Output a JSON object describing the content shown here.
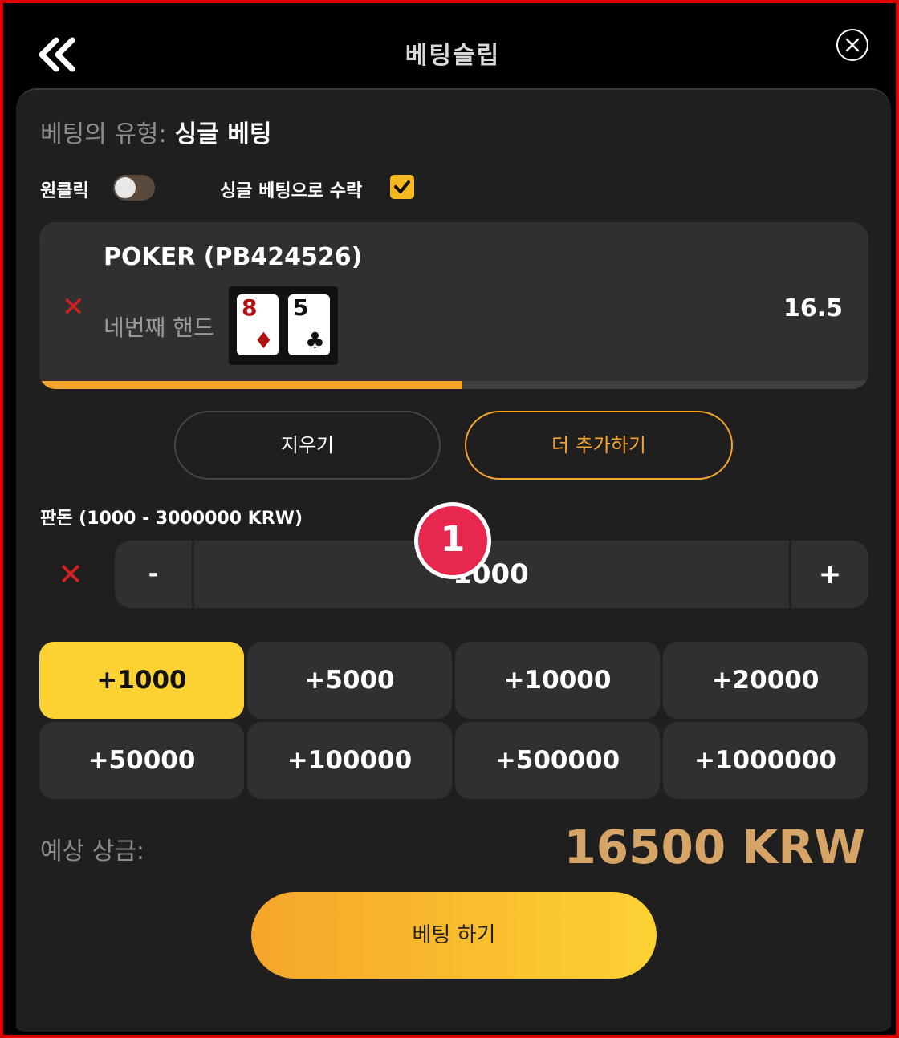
{
  "header": {
    "title": "베팅슬립"
  },
  "bet_type": {
    "label": "베팅의 유형:",
    "value": "싱글 베팅"
  },
  "options": {
    "one_click_label": "원클릭",
    "one_click_on": false,
    "accept_single_label": "싱글 베팅으로 수락",
    "accept_single_checked": true
  },
  "selection": {
    "game": "POKER (PB424526)",
    "market": "네번째 핸드",
    "cards": [
      {
        "rank": "8",
        "suit": "♦",
        "color": "#b01010"
      },
      {
        "rank": "5",
        "suit": "♣",
        "color": "#111111"
      }
    ],
    "odds": "16.5",
    "progress_fraction": 0.51
  },
  "actions": {
    "clear_label": "지우기",
    "add_more_label": "더 추가하기"
  },
  "stake": {
    "label": "판돈 (1000 - 3000000 KRW)",
    "minus": "-",
    "value": "1000",
    "plus": "+",
    "marker": "1"
  },
  "quick_amounts": [
    "+1000",
    "+5000",
    "+10000",
    "+20000",
    "+50000",
    "+100000",
    "+500000",
    "+1000000"
  ],
  "payout": {
    "label": "예상 상금:",
    "value": "16500 KRW"
  },
  "place_bet_label": "베팅 하기",
  "colors": {
    "accent": "#f6a52b",
    "accent_yellow": "#fcd232",
    "payout": "#d7a468",
    "error_red": "#d32020",
    "badge": "#e8274f"
  }
}
